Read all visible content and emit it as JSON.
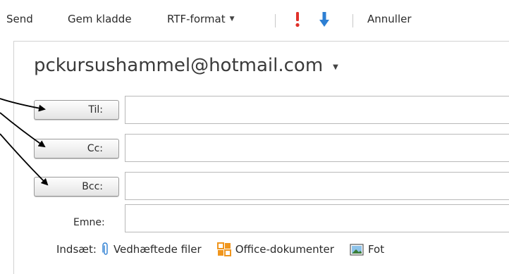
{
  "toolbar": {
    "send_label": "Send",
    "save_draft_label": "Gem kladde",
    "format_label": "RTF-format",
    "cancel_label": "Annuller",
    "high_priority_icon": "exclamation-icon",
    "low_priority_icon": "down-arrow-icon"
  },
  "from": {
    "address": "pckursushammel@hotmail.com"
  },
  "recipients": {
    "to_label": "Til:",
    "cc_label": "Cc:",
    "bcc_label": "Bcc:",
    "to_value": "",
    "cc_value": "",
    "bcc_value": ""
  },
  "subject": {
    "label": "Emne:",
    "value": ""
  },
  "insert": {
    "label": "Indsæt:",
    "attachments_label": "Vedhæftede filer",
    "office_docs_label": "Office-dokumenter",
    "photos_label": "Fot"
  },
  "colors": {
    "high_priority": "#e0312a",
    "low_priority": "#2d7fd3",
    "office_icon": "#f0961e"
  }
}
